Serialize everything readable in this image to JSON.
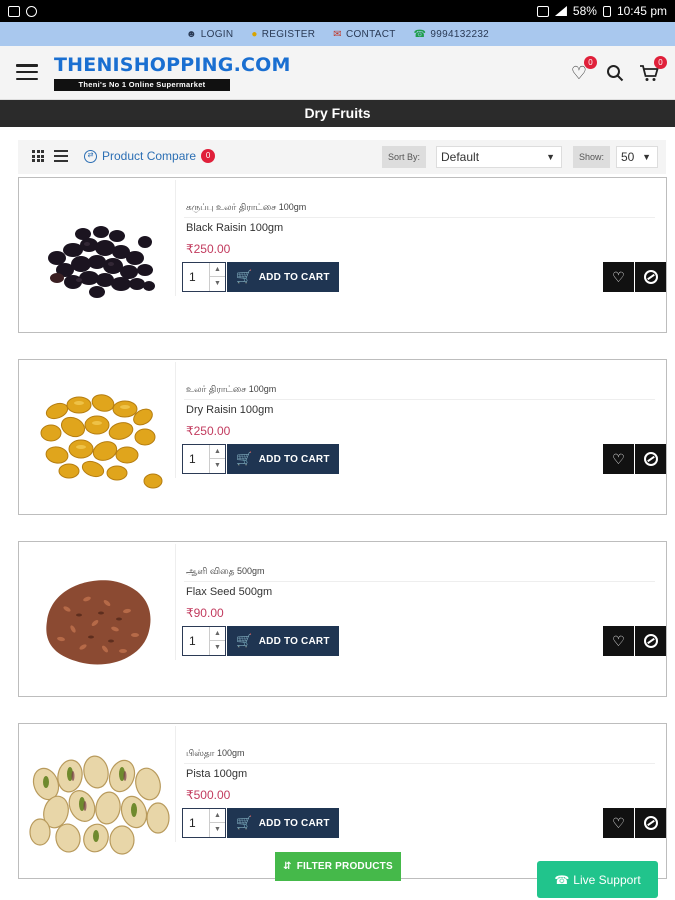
{
  "statusbar": {
    "battery": "58%",
    "time": "10:45 pm"
  },
  "topbar": {
    "login": "LOGIN",
    "register": "REGISTER",
    "contact": "CONTACT",
    "phone": "9994132232"
  },
  "header": {
    "logo_text": "THENISHOPPING.COM",
    "logo_tagline": "Theni's No 1 Online Supermarket",
    "wishlist_count": "0",
    "cart_count": "0"
  },
  "category": {
    "title": "Dry Fruits"
  },
  "toolbar": {
    "compare_label": "Product Compare",
    "compare_count": "0",
    "sort_label": "Sort By:",
    "sort_value": "Default",
    "show_label": "Show:",
    "show_value": "50"
  },
  "products": [
    {
      "tamil_name": "கருப்பு உலர் திராட்சை 100gm",
      "name": "Black Raisin 100gm",
      "price": "₹250.00",
      "qty": "1",
      "add_label": "ADD TO CART"
    },
    {
      "tamil_name": "உலர் திராட்சை 100gm",
      "name": "Dry Raisin 100gm",
      "price": "₹250.00",
      "qty": "1",
      "add_label": "ADD TO CART"
    },
    {
      "tamil_name": "ஆளி விதை 500gm",
      "name": "Flax Seed 500gm",
      "price": "₹90.00",
      "qty": "1",
      "add_label": "ADD TO CART"
    },
    {
      "tamil_name": "பிஸ்தா 100gm",
      "name": "Pista 100gm",
      "price": "₹500.00",
      "qty": "1",
      "add_label": "ADD TO CART"
    }
  ],
  "floating": {
    "filter_label": "FILTER PRODUCTS",
    "live_support_label": "Live Support"
  },
  "colors": {
    "topbar": "#a9c8ee",
    "catbar": "#2b2b2b",
    "add_to_cart": "#1f3552",
    "price": "#c23b5e",
    "filter": "#45b94a",
    "live_support": "#21c48c",
    "badge": "#e0203a"
  }
}
